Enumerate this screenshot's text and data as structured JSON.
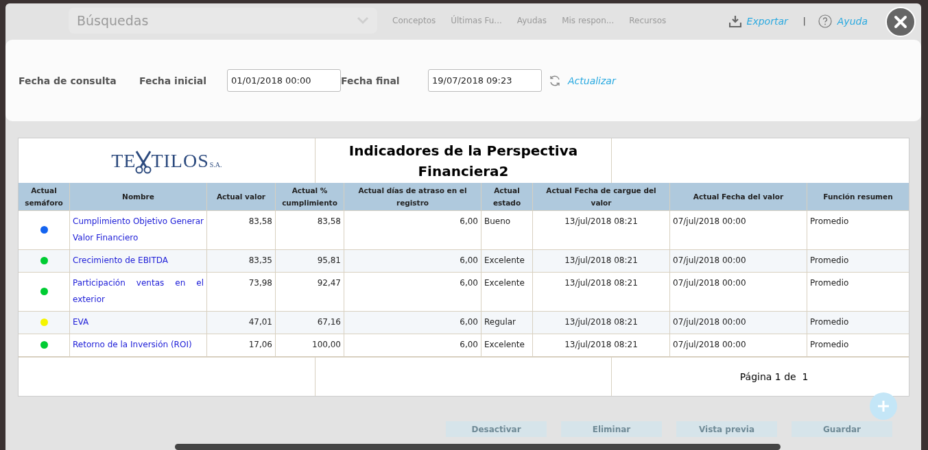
{
  "background": {
    "search": {
      "placeholder": "Búsquedas"
    },
    "nav": [
      "Conceptos",
      "Últimas Fu...",
      "Ayudas",
      "Mis respon...",
      "Recursos"
    ],
    "buttons": [
      "Desactivar",
      "Eliminar",
      "Vista previa",
      "Guardar"
    ]
  },
  "toolbar": {
    "export": "Exportar",
    "separator": "|",
    "help": "Ayuda"
  },
  "filter": {
    "title": "Fecha de consulta",
    "start_label": "Fecha inicial",
    "start_value": "01/01/2018 00:00",
    "end_label": "Fecha final",
    "end_value": "19/07/2018 09:23",
    "refresh": "Actualizar"
  },
  "report": {
    "logo": {
      "parts": [
        "TE",
        "TILOS"
      ],
      "suffix": "S.A."
    },
    "title": "Indicadores de la Perspectiva Financiera2",
    "columns": [
      "Actual semáforo",
      "Nombre",
      "Actual valor",
      "Actual % cumplimiento",
      "Actual días de atraso en el registro",
      "Actual estado",
      "Actual Fecha de cargue del valor",
      "Actual Fecha del valor",
      "Función resumen"
    ],
    "rows": [
      {
        "color": "#1464f0",
        "cells": [
          "",
          "Cumplimiento Objetivo Generar Valor Financiero",
          "83,58",
          "83,58",
          "6,00",
          "Bueno",
          "13/jul/2018 08:21",
          "07/jul/2018 00:00",
          "Promedio"
        ]
      },
      {
        "color": "#00cc33",
        "cells": [
          "",
          "Crecimiento de EBITDA",
          "83,35",
          "95,81",
          "6,00",
          "Excelente",
          "13/jul/2018 08:21",
          "07/jul/2018 00:00",
          "Promedio"
        ]
      },
      {
        "color": "#00cc33",
        "cells": [
          "",
          "Participación ventas en el exterior",
          "73,98",
          "92,47",
          "6,00",
          "Excelente",
          "13/jul/2018 08:21",
          "07/jul/2018 00:00",
          "Promedio"
        ]
      },
      {
        "color": "#f5f500",
        "cells": [
          "",
          "EVA",
          "47,01",
          "67,16",
          "6,00",
          "Regular",
          "13/jul/2018 08:21",
          "07/jul/2018 00:00",
          "Promedio"
        ]
      },
      {
        "color": "#00cc33",
        "cells": [
          "",
          "Retorno de la Inversión (ROI)",
          "17,06",
          "100,00",
          "6,00",
          "Excelente",
          "13/jul/2018 08:21",
          "07/jul/2018 00:00",
          "Promedio"
        ]
      }
    ],
    "footer": "Página 1 de  1"
  }
}
